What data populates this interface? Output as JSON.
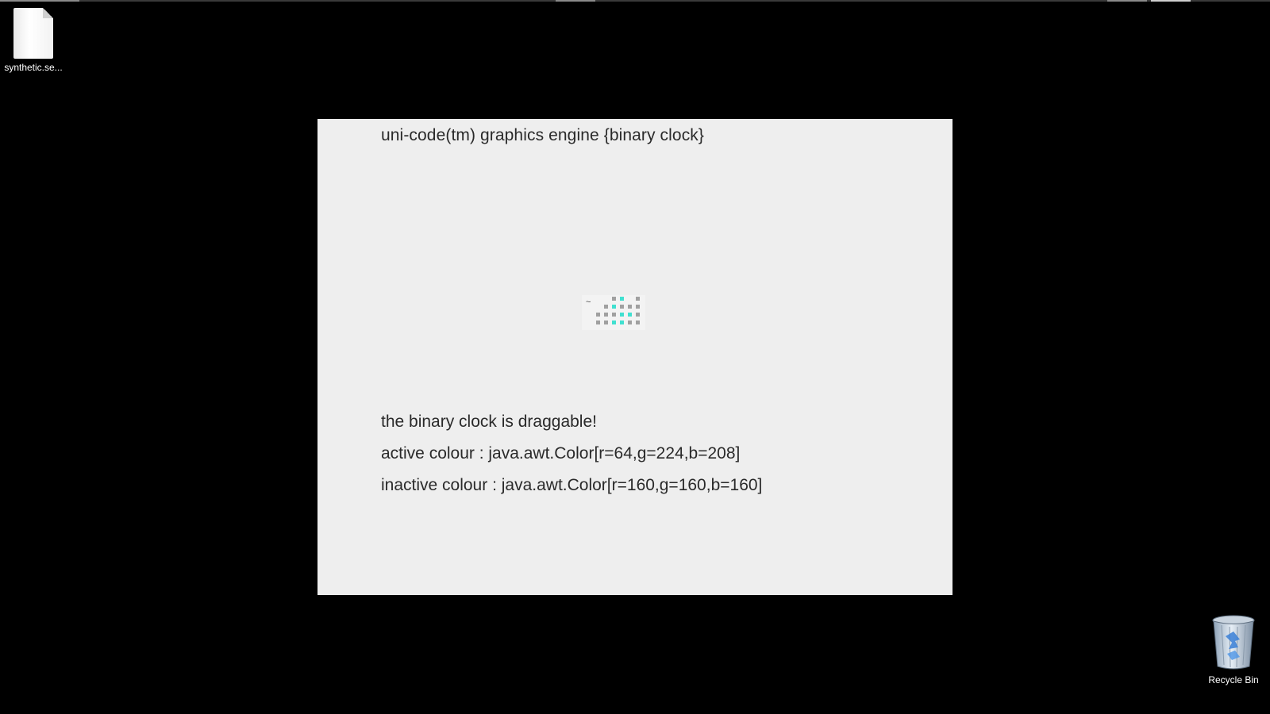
{
  "desktop": {
    "file_icon": {
      "label": "synthetic.se..."
    },
    "recycle_bin": {
      "label": "Recycle Bin"
    }
  },
  "app": {
    "title": "uni-code(tm) graphics engine {binary clock}",
    "lines": {
      "draggable": "the binary clock is draggable!",
      "active_colour": "active colour : java.awt.Color[r=64,g=224,b=208]",
      "inactive_colour": "inactive colour : java.awt.Color[r=160,g=160,b=160]"
    },
    "clock": {
      "handle": "~",
      "active_color": "#40e0d0",
      "inactive_color": "#a0a0a0",
      "columns": [
        {
          "bits": [
            0,
            0
          ]
        },
        {
          "bits": [
            0,
            0,
            0
          ]
        },
        {
          "bits": [
            0,
            1,
            0,
            1
          ]
        },
        {
          "bits": [
            1,
            0,
            1,
            1
          ]
        },
        {
          "bits": [
            0,
            1,
            0
          ]
        },
        {
          "bits": [
            0,
            0,
            0,
            0
          ]
        }
      ]
    }
  }
}
